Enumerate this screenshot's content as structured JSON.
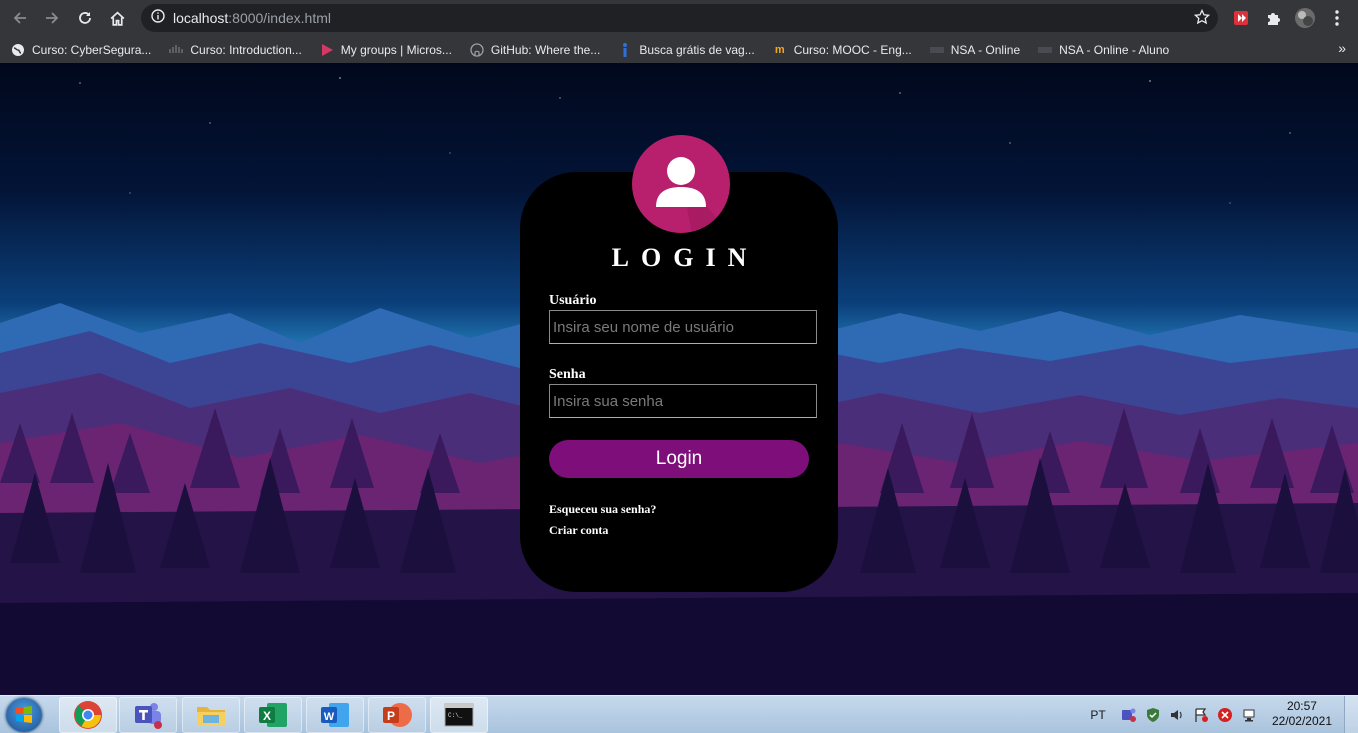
{
  "browser": {
    "url_host": "localhost",
    "url_rest": ":8000/index.html",
    "icons": [
      "back-icon",
      "forward-icon",
      "reload-icon",
      "home-icon",
      "info-icon",
      "star-icon",
      "extension-icon",
      "puzzle-icon",
      "profile-avatar",
      "menu-icon"
    ]
  },
  "bookmarks": [
    {
      "label": "Curso: CyberSegura...",
      "icon": "globe-icon"
    },
    {
      "label": "Curso: Introduction...",
      "icon": "cisco-icon"
    },
    {
      "label": "My groups | Micros...",
      "icon": "stream-icon"
    },
    {
      "label": "GitHub: Where the...",
      "icon": "github-icon"
    },
    {
      "label": "Busca grátis de vag...",
      "icon": "job-icon"
    },
    {
      "label": "Curso: MOOC - Eng...",
      "icon": "mooc-icon"
    },
    {
      "label": "NSA - Online",
      "icon": "nsa-icon"
    },
    {
      "label": "NSA - Online - Aluno",
      "icon": "nsa-icon"
    }
  ],
  "bookmarks_more": "»",
  "login": {
    "title": "LOGIN",
    "username_label": "Usuário",
    "username_placeholder": "Insira seu nome de usuário",
    "password_label": "Senha",
    "password_placeholder": "Insira sua senha",
    "button": "Login",
    "forgot": "Esqueceu sua senha?",
    "create": "Criar conta"
  },
  "taskbar": {
    "apps": [
      "chrome-icon",
      "teams-icon",
      "explorer-icon",
      "excel-icon",
      "word-icon",
      "powerpoint-icon",
      "cmd-icon"
    ],
    "excel_letter": "X",
    "word_letter": "W",
    "powerpoint_letter": "P",
    "cmd_text": "C:\\_",
    "language": "PT",
    "time": "20:57",
    "date": "22/02/2021"
  },
  "colors": {
    "avatar": "#b81f6c",
    "button": "#7e0f7a",
    "card": "#000000"
  }
}
